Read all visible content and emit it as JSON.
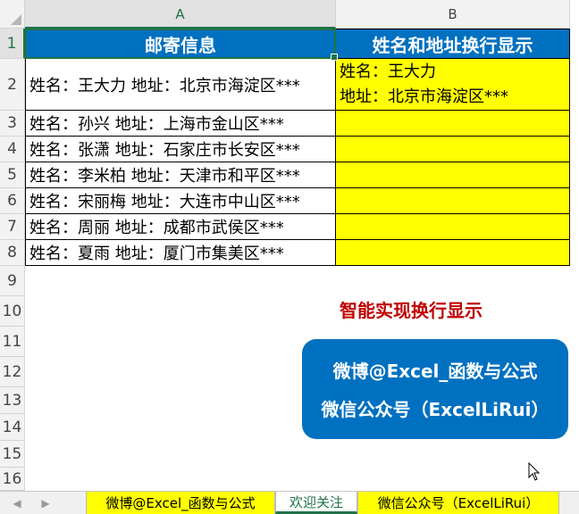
{
  "columns": [
    "A",
    "B"
  ],
  "rows": [
    "1",
    "2",
    "3",
    "4",
    "5",
    "6",
    "7",
    "8",
    "9",
    "10",
    "11",
    "12",
    "13",
    "14",
    "15",
    "16"
  ],
  "table": {
    "header_a": "邮寄信息",
    "header_b": "姓名和地址换行显示",
    "a_cells": [
      "姓名：王大力 地址：北京市海淀区***",
      "姓名：孙兴 地址：上海市金山区***",
      "姓名：张潇 地址：石家庄市长安区***",
      "姓名：李米柏 地址：天津市和平区***",
      "姓名：宋丽梅 地址：大连市中山区***",
      "姓名：周丽 地址：成都市武侯区***",
      "姓名：夏雨 地址：厦门市集美区***"
    ],
    "b2_line1": "姓名：王大力",
    "b2_line2": "地址：北京市海淀区***"
  },
  "headline": "智能实现换行显示",
  "badge": {
    "line1": "微博@Excel_函数与公式",
    "line2": "微信公众号（ExcelLiRui）"
  },
  "tabs": [
    {
      "label": "微博@Excel_函数与公式"
    },
    {
      "label": "欢迎关注"
    },
    {
      "label": "微信公众号（ExcelLiRui）"
    }
  ],
  "colors": {
    "header_blue": "#0070c0",
    "fill_yellow": "#ffff00",
    "headline_red": "#c00000",
    "excel_green": "#217346"
  },
  "icons": {
    "prev": "triangle-left",
    "next": "triangle-right",
    "cursor": "mouse-pointer"
  }
}
